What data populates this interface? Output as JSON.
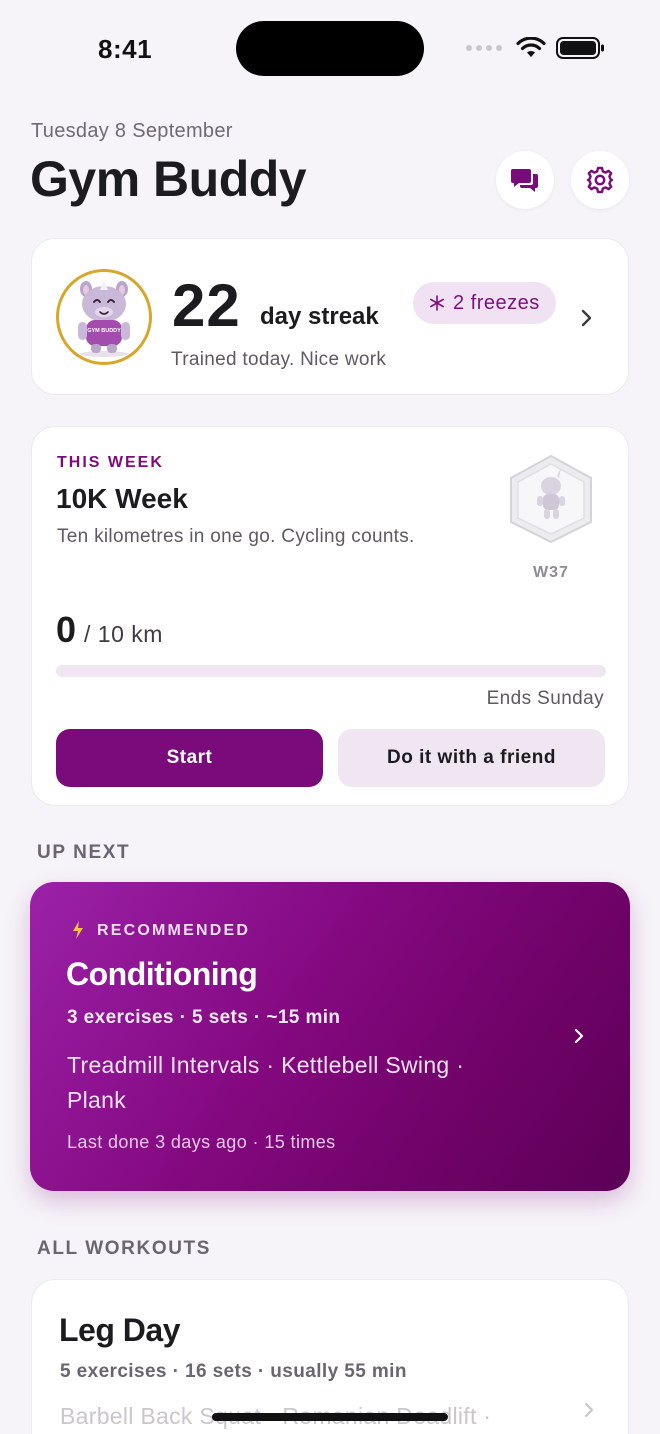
{
  "status_bar": {
    "time": "8:41"
  },
  "header": {
    "date": "Tuesday 8 September",
    "title": "Gym Buddy",
    "icons": [
      "chat-icon",
      "gear-icon"
    ]
  },
  "streak": {
    "mascot_text": "GYM BUDDY",
    "count": "22",
    "label": "day streak",
    "subtitle": "Trained today. Nice work",
    "freezes": "2 freezes"
  },
  "challenge": {
    "eyebrow": "THIS WEEK",
    "title": "10K Week",
    "description": "Ten kilometres in one go. Cycling counts.",
    "badge_label": "W37",
    "progress_value": "0",
    "progress_total": "/ 10 km",
    "progress_fraction": 0,
    "ends": "Ends Sunday",
    "start_label": "Start",
    "friend_label": "Do it with a friend"
  },
  "up_next": {
    "section_label": "UP NEXT",
    "tag": "RECOMMENDED",
    "title": "Conditioning",
    "meta": "3 exercises · 5 sets · ~15 min",
    "exercises_line1": "Treadmill Intervals · Kettlebell Swing ·",
    "exercises_line2": "Plank",
    "last_done": "Last done 3 days ago · 15 times"
  },
  "all_workouts": {
    "section_label": "ALL WORKOUTS",
    "items": [
      {
        "title": "Leg Day",
        "meta": "5 exercises · 16 sets · usually 55 min",
        "exercises": "Barbell Back Squat · Romanian Deadlift ·"
      }
    ]
  },
  "colors": {
    "accent": "#7b0a7b",
    "accent_soft": "#f0e6f2",
    "streak_ring": "#d8a62a",
    "background": "#f6f4f8"
  }
}
